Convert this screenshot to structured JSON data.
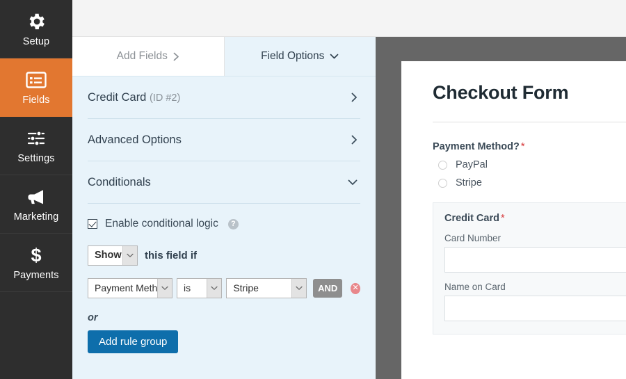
{
  "sidebar": {
    "items": [
      {
        "label": "Setup",
        "icon": "gear-icon",
        "active": false
      },
      {
        "label": "Fields",
        "icon": "list-fields-icon",
        "active": true
      },
      {
        "label": "Settings",
        "icon": "sliders-icon",
        "active": false
      },
      {
        "label": "Marketing",
        "icon": "megaphone-icon",
        "active": false
      },
      {
        "label": "Payments",
        "icon": "dollar-icon",
        "active": false
      }
    ],
    "active_color": "#e27730",
    "background": "#2e2e2e"
  },
  "tabs": {
    "add_fields": "Add Fields",
    "add_fields_icon": "chevron-right-icon",
    "field_options": "Field Options",
    "field_options_icon": "chevron-down-icon"
  },
  "sections": [
    {
      "title": "Credit Card",
      "sub": "(ID #2)",
      "arrow": "chevron-right-icon",
      "expanded": false
    },
    {
      "title": "Advanced Options",
      "sub": "",
      "arrow": "chevron-right-icon",
      "expanded": false
    },
    {
      "title": "Conditionals",
      "sub": "",
      "arrow": "chevron-down-icon",
      "expanded": true
    }
  ],
  "conditionals": {
    "enable_label": "Enable conditional logic",
    "enable_checked": true,
    "help_icon": "question-mark-icon",
    "show_select": "Show",
    "this_field_if": "this field if",
    "rule": {
      "field": "Payment Meth",
      "operator": "is",
      "value": "Stripe",
      "and_label": "AND",
      "delete_icon": "close-circle-icon"
    },
    "or_label": "or",
    "add_rule_group": "Add rule group",
    "button_color": "#0e6eab"
  },
  "preview": {
    "form_title": "Checkout Form",
    "payment_question": "Payment Method?",
    "required_mark": "*",
    "options": [
      {
        "label": "PayPal",
        "selected": false
      },
      {
        "label": "Stripe",
        "selected": false
      }
    ],
    "credit_card": {
      "title": "Credit Card",
      "required_mark": "*",
      "fields": [
        {
          "label": "Card Number",
          "value": ""
        },
        {
          "label": "Name on Card",
          "value": ""
        }
      ]
    },
    "required_color": "#d63638"
  }
}
